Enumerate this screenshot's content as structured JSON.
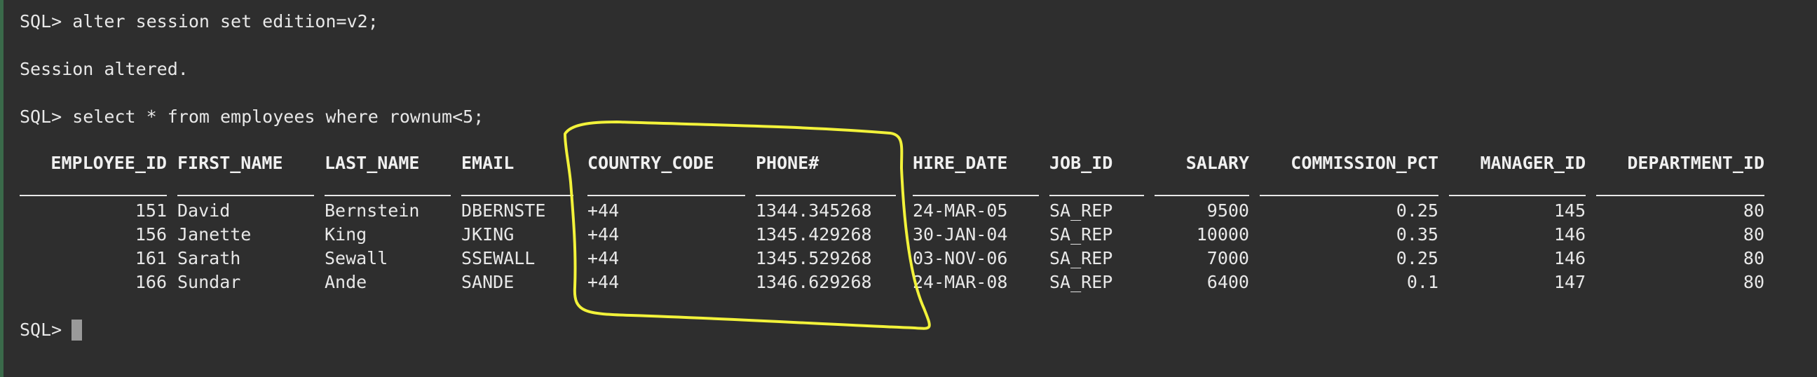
{
  "terminal": {
    "cmd1": "SQL> alter session set edition=v2;",
    "msg1": "Session altered.",
    "cmd2": "SQL> select * from employees where rownum<5;",
    "prompt": "SQL> "
  },
  "table": {
    "columns": [
      "EMPLOYEE_ID",
      "FIRST_NAME",
      "LAST_NAME",
      "EMAIL",
      "COUNTRY_CODE",
      "PHONE#",
      "HIRE_DATE",
      "JOB_ID",
      "SALARY",
      "COMMISSION_PCT",
      "MANAGER_ID",
      "DEPARTMENT_ID"
    ],
    "rows": [
      [
        "151",
        "David",
        "Bernstein",
        "DBERNSTE",
        "+44",
        "1344.345268",
        "24-MAR-05",
        "SA_REP",
        "9500",
        "0.25",
        "145",
        "80"
      ],
      [
        "156",
        "Janette",
        "King",
        "JKING",
        "+44",
        "1345.429268",
        "30-JAN-04",
        "SA_REP",
        "10000",
        "0.35",
        "146",
        "80"
      ],
      [
        "161",
        "Sarath",
        "Sewall",
        "SSEWALL",
        "+44",
        "1345.529268",
        "03-NOV-06",
        "SA_REP",
        "7000",
        "0.25",
        "146",
        "80"
      ],
      [
        "166",
        "Sundar",
        "Ande",
        "SANDE",
        "+44",
        "1346.629268",
        "24-MAR-08",
        "SA_REP",
        "6400",
        "0.1",
        "147",
        "80"
      ]
    ]
  },
  "colors": {
    "background": "#2e2e2e",
    "text": "#e8e8e8",
    "highlight": "#f2f23a",
    "cursor": "#9a9a9a"
  }
}
